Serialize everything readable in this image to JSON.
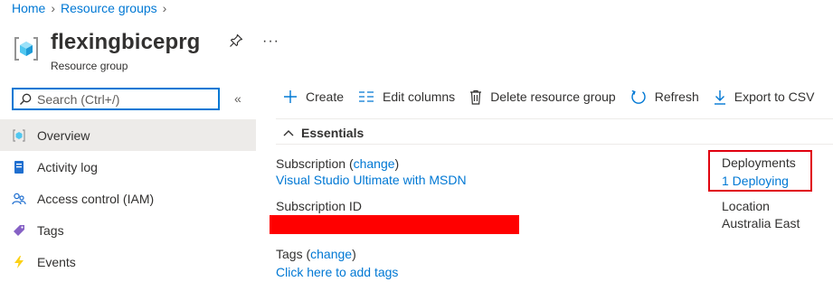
{
  "breadcrumb": {
    "items": [
      "Home",
      "Resource groups"
    ]
  },
  "header": {
    "title": "flexingbiceprg",
    "subtitle": "Resource group",
    "more": "···"
  },
  "search": {
    "placeholder": "Search (Ctrl+/)",
    "collapse": "«"
  },
  "nav": {
    "items": [
      {
        "label": "Overview",
        "icon": "resource-group-icon",
        "active": true
      },
      {
        "label": "Activity log",
        "icon": "activity-log-icon"
      },
      {
        "label": "Access control (IAM)",
        "icon": "people-icon"
      },
      {
        "label": "Tags",
        "icon": "tag-icon"
      },
      {
        "label": "Events",
        "icon": "lightning-icon"
      }
    ]
  },
  "toolbar": {
    "create": "Create",
    "edit_columns": "Edit columns",
    "delete": "Delete resource group",
    "refresh": "Refresh",
    "export": "Export to CSV"
  },
  "essentials": {
    "heading": "Essentials",
    "subscription_label": "Subscription",
    "subscription_change": "change",
    "subscription_value": "Visual Studio Ultimate with MSDN",
    "subscription_id_label": "Subscription ID",
    "tags_label": "Tags",
    "tags_change": "change",
    "tags_value": "Click here to add tags",
    "deployments_label": "Deployments",
    "deployments_value": "1 Deploying",
    "location_label": "Location",
    "location_value": "Australia East"
  },
  "colors": {
    "accent": "#0078d4",
    "active_bg": "#edebe9",
    "redaction": "#ff0000",
    "highlight_border": "#e0000f"
  }
}
